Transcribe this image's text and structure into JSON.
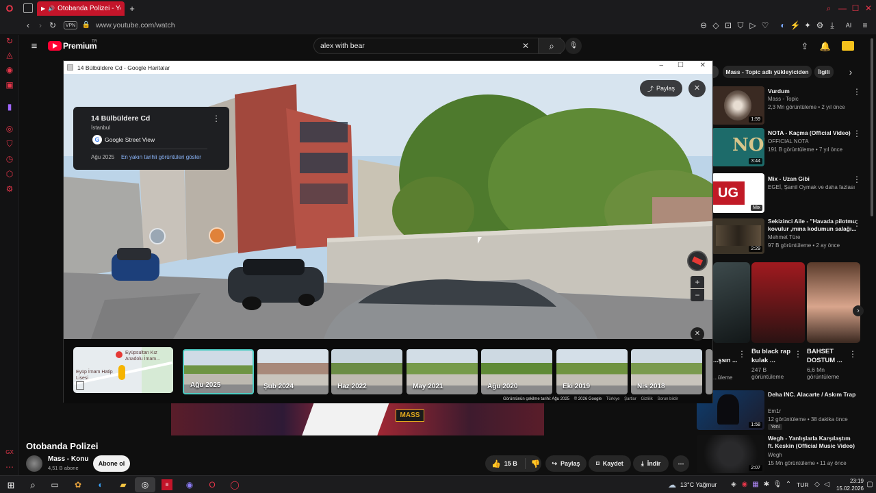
{
  "browser": {
    "tab_title": "Otobanda Polizei - You",
    "url": "www.youtube.com/watch",
    "vpn": "VPN",
    "aria_label": "AI"
  },
  "youtube": {
    "logo": "Premium",
    "logo_sup": "TR",
    "search_value": "alex with bear",
    "chips": [
      "Mass - Topic adlı yükleyiciden",
      "İlgili"
    ],
    "video_title": "Otobanda Polizei",
    "channel_name": "Mass - Konu",
    "subs": "4,51 B abone",
    "subscribe": "Abone ol",
    "likes": "15 B",
    "share": "Paylaş",
    "save": "Kaydet",
    "download": "İndir",
    "player_logo": "MASS"
  },
  "maps": {
    "window_title": "14 Bülbüldere Cd - Google Haritalar",
    "place_title": "14 Bülbüldere Cd",
    "place_city": "İstanbul",
    "source": "Google Street View",
    "date": "Ağu 2025",
    "nearest_link": "En yakın tarihli görüntüleri göster",
    "share": "Paylaş",
    "minimap_label1": "Eyüpsultan Kız Anadolu İmam...",
    "minimap_label2": "Eyüp İmam Hatip Lisesi",
    "timeline": [
      "Ağu 2025",
      "Şub 2024",
      "Haz 2022",
      "May 2021",
      "Ağu 2020",
      "Eki 2019",
      "Nis 2018"
    ],
    "footer": [
      "Görüntünün çekilme tarihi: Ağu 2025",
      "© 2026 Google",
      "Türkiye",
      "Şartlar",
      "Gizlilik",
      "Sorun bildir"
    ]
  },
  "related": [
    {
      "title": "Vurdum",
      "channel": "Mass - Topic",
      "meta": "2,3 Mn görüntüleme • 2 yıl önce",
      "duration": "1:59",
      "thumb": "#3a2a22"
    },
    {
      "title": "NOTA - Kaçma (Official Video)",
      "channel": "OFFICIAL NOTA",
      "meta": "191 B görüntüleme • 7 yıl önce",
      "duration": "3:44",
      "thumb": "#1d6b6a"
    },
    {
      "title": "Mix - Uzan Gibi",
      "channel": "EGEİ, Şamil Oymak ve daha fazlası",
      "meta": "",
      "duration": "Mix",
      "thumb": "#c11a26"
    },
    {
      "title": "Sekizinci Aile - \"Havada pilotmu kovulur ,mına kodumun salağı...",
      "channel": "Mehmet Türe",
      "meta": "97 B görüntüleme • 2 ay önce",
      "duration": "2:29",
      "thumb": "#3b3327"
    }
  ],
  "shorts": [
    {
      "title": "...şsın ...",
      "meta": "...üleme"
    },
    {
      "title": "Bu black rap kulak ...",
      "meta": "247 B görüntüleme"
    },
    {
      "title": "BAHSET DOSTUM ...",
      "meta": "6,6 Mn görüntüleme"
    }
  ],
  "related2": [
    {
      "title": "Deha INC. Alacarte / Askım Trap",
      "channel": "Em1r",
      "meta": "12 görüntüleme • 38 dakika önce",
      "badge": "Yeni",
      "duration": "1:58"
    },
    {
      "title": "Wegh - Yanlışlarla Karşılaştım ft. Keskin (Official Music Video)",
      "channel": "Wegh",
      "meta": "15 Mn görüntüleme • 11 ay önce",
      "duration": "2:07"
    }
  ],
  "taskbar": {
    "weather": "13°C Yağmur",
    "lang": "TUR",
    "time": "23:19",
    "date": "15.02.2026"
  },
  "colors": {
    "yt_red": "#ff0033",
    "opera_red": "#e8364a",
    "accent_teal": "#4ecdc4"
  }
}
